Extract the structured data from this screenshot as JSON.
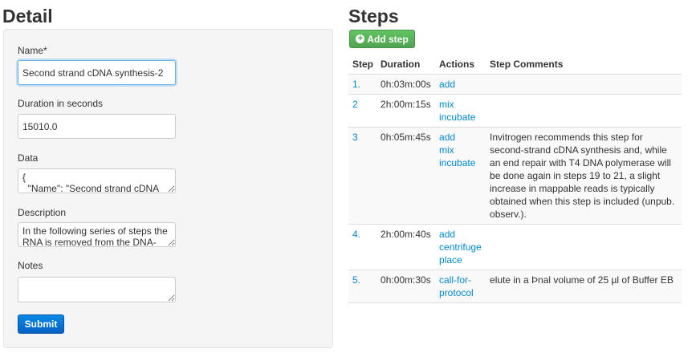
{
  "detail": {
    "title": "Detail",
    "name_label": "Name*",
    "name_value": "Second strand cDNA synthesis-2",
    "duration_label": "Duration in seconds",
    "duration_value": "15010.0",
    "data_label": "Data",
    "data_value": "{\n  \"Name\": \"Second strand cDNA",
    "description_label": "Description",
    "description_value": "In the following series of steps the RNA is removed from the DNA-",
    "notes_label": "Notes",
    "notes_value": "",
    "submit_label": "Submit"
  },
  "steps": {
    "title": "Steps",
    "add_button_label": "Add step",
    "columns": [
      "Step",
      "Duration",
      "Actions",
      "Step Comments"
    ],
    "rows": [
      {
        "step": "1.",
        "duration": "0h:03m:00s",
        "actions": [
          "add"
        ],
        "comment": ""
      },
      {
        "step": "2",
        "duration": "2h:00m:15s",
        "actions": [
          "mix",
          "incubate"
        ],
        "comment": ""
      },
      {
        "step": "3",
        "duration": "0h:05m:45s",
        "actions": [
          "add",
          "mix",
          "incubate"
        ],
        "comment": "Invitrogen recommends this step for second-strand cDNA synthesis and, while an end repair with T4 DNA polymerase will be done again in steps 19 to 21, a slight increase in mappable reads is typically obtained when this step is included (unpub. observ.)."
      },
      {
        "step": "4.",
        "duration": "2h:00m:40s",
        "actions": [
          "add",
          "centrifuge",
          "place"
        ],
        "comment": ""
      },
      {
        "step": "5.",
        "duration": "0h:00m:30s",
        "actions": [
          "call-for-protocol"
        ],
        "comment": "elute in a Þnal volume of 25 µl of Buffer EB"
      }
    ]
  }
}
